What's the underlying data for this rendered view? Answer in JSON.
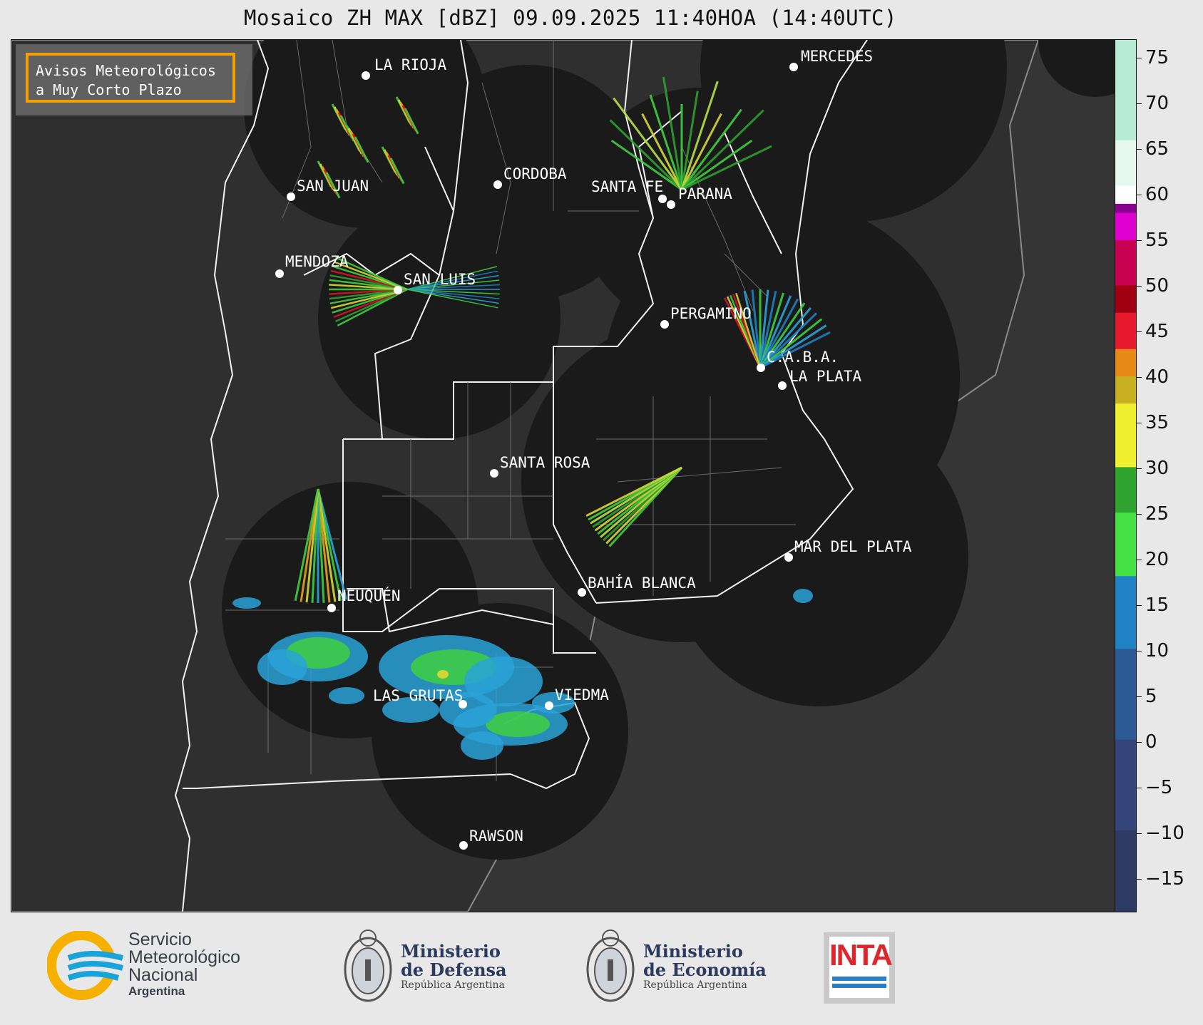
{
  "title": "Mosaico ZH MAX [dBZ] 09.09.2025 11:40HOA (14:40UTC)",
  "notice": {
    "line1": "Avisos Meteorológicos",
    "line2": "a Muy Corto Plazo",
    "border_color": "#f5a000"
  },
  "cities": [
    {
      "name": "LA RIOJA"
    },
    {
      "name": "MERCEDES"
    },
    {
      "name": "CORDOBA"
    },
    {
      "name": "SAN JUAN"
    },
    {
      "name": "SANTA FE"
    },
    {
      "name": "PARANA"
    },
    {
      "name": "MENDOZA"
    },
    {
      "name": "SAN LUIS"
    },
    {
      "name": "PERGAMINO"
    },
    {
      "name": "C.A.B.A."
    },
    {
      "name": "LA PLATA"
    },
    {
      "name": "SANTA ROSA"
    },
    {
      "name": "MAR DEL PLATA"
    },
    {
      "name": "BAHÍA BLANCA"
    },
    {
      "name": "NEUQUÉN"
    },
    {
      "name": "LAS GRUTAS"
    },
    {
      "name": "VIEDMA"
    },
    {
      "name": "RAWSON"
    }
  ],
  "colorbar": {
    "ticks": [
      "75",
      "70",
      "65",
      "60",
      "55",
      "50",
      "45",
      "40",
      "35",
      "30",
      "25",
      "20",
      "15",
      "10",
      "5",
      "0",
      "−5",
      "−10",
      "−15"
    ],
    "range": [
      -18.5,
      77
    ]
  },
  "logos": {
    "smn": {
      "line1": "Servicio",
      "line2": "Meteorológico",
      "line3": "Nacional",
      "line4": "Argentina"
    },
    "defensa": {
      "line1": "Ministerio",
      "line2": "de Defensa",
      "line3": "República Argentina"
    },
    "economia": {
      "line1": "Ministerio",
      "line2": "de Economía",
      "line3": "República Argentina"
    },
    "inta": {
      "text": "INTA"
    }
  }
}
